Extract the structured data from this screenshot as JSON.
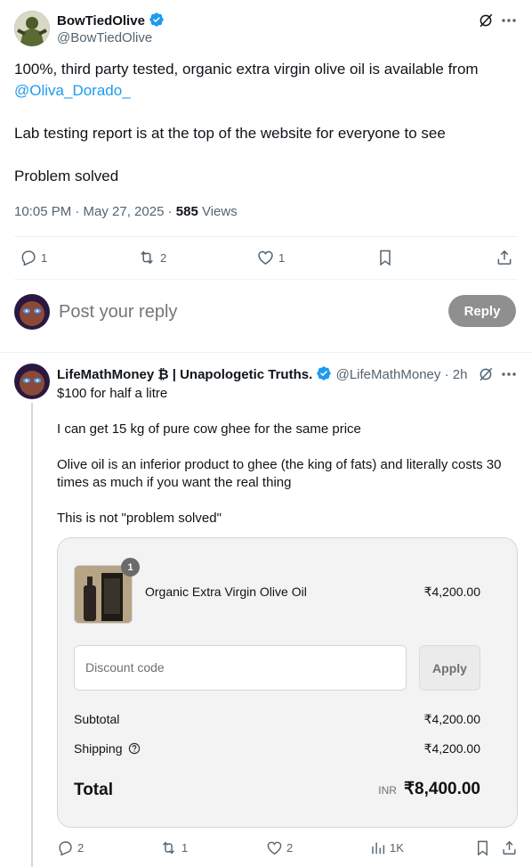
{
  "tweet": {
    "author_name": "BowTiedOlive",
    "author_handle": "@BowTiedOlive",
    "text_line1": "100%, third party tested, organic extra virgin olive oil is available from",
    "mention": "@Oliva_Dorado_",
    "text_para2": "Lab testing report is at the top of the website for everyone to see",
    "text_para3": "Problem solved",
    "timestamp": "10:05 PM · May 27, 2025 · ",
    "views_count": "585",
    "views_label": " Views",
    "replies": "1",
    "reposts": "2",
    "likes": "1"
  },
  "composer": {
    "placeholder": "Post your reply",
    "button_label": "Reply"
  },
  "reply": {
    "author_name": "LifeMathMoney ₿ | Unapologetic Truths.",
    "author_handle": "@LifeMathMoney",
    "time": "· 2h",
    "line1": "$100 for half a litre",
    "para2": "I can get 15 kg of pure cow ghee for the same price",
    "para3_line1": "Olive oil is an inferior product to ghee (the king of fats) and literally costs 30",
    "para3_line2": "times as much if you want the real thing",
    "para4": "This is not \"problem solved\"",
    "replies": "2",
    "reposts": "1",
    "likes": "2",
    "views": "1K"
  },
  "checkout": {
    "item_qty": "1",
    "item_name": "Organic Extra Virgin Olive Oil",
    "item_price": "₹4,200.00",
    "discount_placeholder": "Discount code",
    "apply_label": "Apply",
    "subtotal_label": "Subtotal",
    "subtotal_value": "₹4,200.00",
    "shipping_label": "Shipping",
    "shipping_value": "₹4,200.00",
    "total_label": "Total",
    "currency": "INR",
    "total_value": "₹8,400.00"
  },
  "colors": {
    "accent": "#1d9bf0",
    "muted": "#536471",
    "reply_button": "#8f8f8f"
  }
}
